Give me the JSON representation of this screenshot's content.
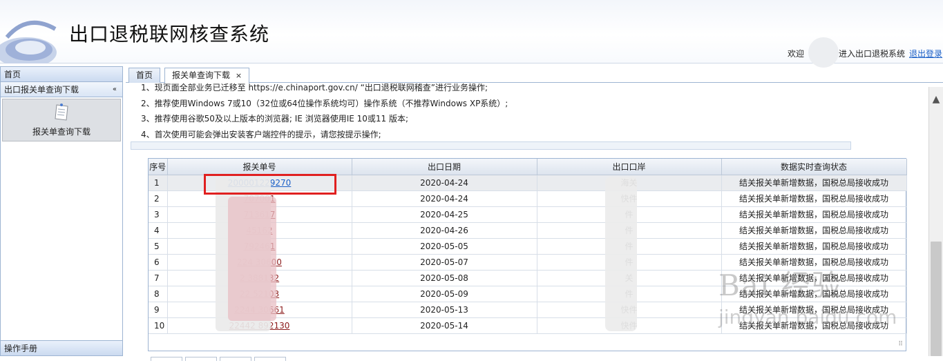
{
  "header": {
    "title": "出口退税联网核查系统",
    "welcome_prefix": "欢迎",
    "welcome_suffix": "进入出口退税系统",
    "logout": "退出登录"
  },
  "sidebar": {
    "home": "首页",
    "section": "出口报关单查询下载",
    "collapse": "«",
    "tile_label": "报关单查询下载",
    "manual": "操作手册"
  },
  "tabs": {
    "home": "首页",
    "download": "报关单查询下载",
    "close": "×"
  },
  "notices": [
    "1、现页面全部业务已迁移至 https://e.chinaport.gov.cn/ “出口退税联网稽查”进行业务操作;",
    "2、推荐使用Windows 7或10（32位或64位操作系统均可）操作系统（不推荐Windows XP系统）;",
    "3、推荐使用谷歌50及以上版本的浏览器; IE 浏览器使用IE 10或11 版本;",
    "4、首次使用可能会弹出安装客户端控件的提示，请您按提示操作;"
  ],
  "table": {
    "columns": [
      "序号",
      "报关单号",
      "出口日期",
      "出口口岸",
      "数据实时查询状态"
    ],
    "rows": [
      {
        "no": "1",
        "decl": "200001229270",
        "date": "2020-04-24",
        "port": "海关",
        "status": "结关报关单新增数据，国税总局接收成功"
      },
      {
        "no": "2",
        "decl": "707001",
        "date": "2020-04-24",
        "port": "快件",
        "status": "结关报关单新增数据，国税总局接收成功"
      },
      {
        "no": "3",
        "decl": "713617",
        "date": "2020-04-25",
        "port": "件",
        "status": "结关报关单新增数据，国税总局接收成功"
      },
      {
        "no": "4",
        "decl": "45162",
        "date": "2020-04-26",
        "port": "件",
        "status": "结关报关单新增数据，国税总局接收成功"
      },
      {
        "no": "5",
        "decl": "792461",
        "date": "2020-05-05",
        "port": "件",
        "status": "结关报关单新增数据，国税总局接收成功"
      },
      {
        "no": "6",
        "decl": "224  30600",
        "date": "2020-05-07",
        "port": "件",
        "status": "结关报关单新增数据，国税总局接收成功"
      },
      {
        "no": "7",
        "decl": "2  388132",
        "date": "2020-05-08",
        "port": "关",
        "status": "结关报关单新增数据，国税总局接收成功"
      },
      {
        "no": "8",
        "decl": "22  52103",
        "date": "2020-05-09",
        "port": "件",
        "status": "结关报关单新增数据，国税总局接收成功"
      },
      {
        "no": "9",
        "decl": "2244  30661",
        "date": "2020-05-13",
        "port": "快件",
        "status": "结关报关单新增数据，国税总局接收成功"
      },
      {
        "no": "10",
        "decl": "22442  892130",
        "date": "2020-05-14",
        "port": "快件",
        "status": "结关报关单新增数据，国税总局接收成功"
      }
    ],
    "grip": "⠿"
  },
  "scrollbar": {
    "up": "▲"
  },
  "watermark": {
    "main": "Bai  经验",
    "sub": "jingyan.baidu.com"
  },
  "colors": {
    "link_red": "#8b1a1a",
    "link_blue": "#1a5fc7",
    "highlight": "#e02020",
    "panel_border": "#9db4d2"
  }
}
